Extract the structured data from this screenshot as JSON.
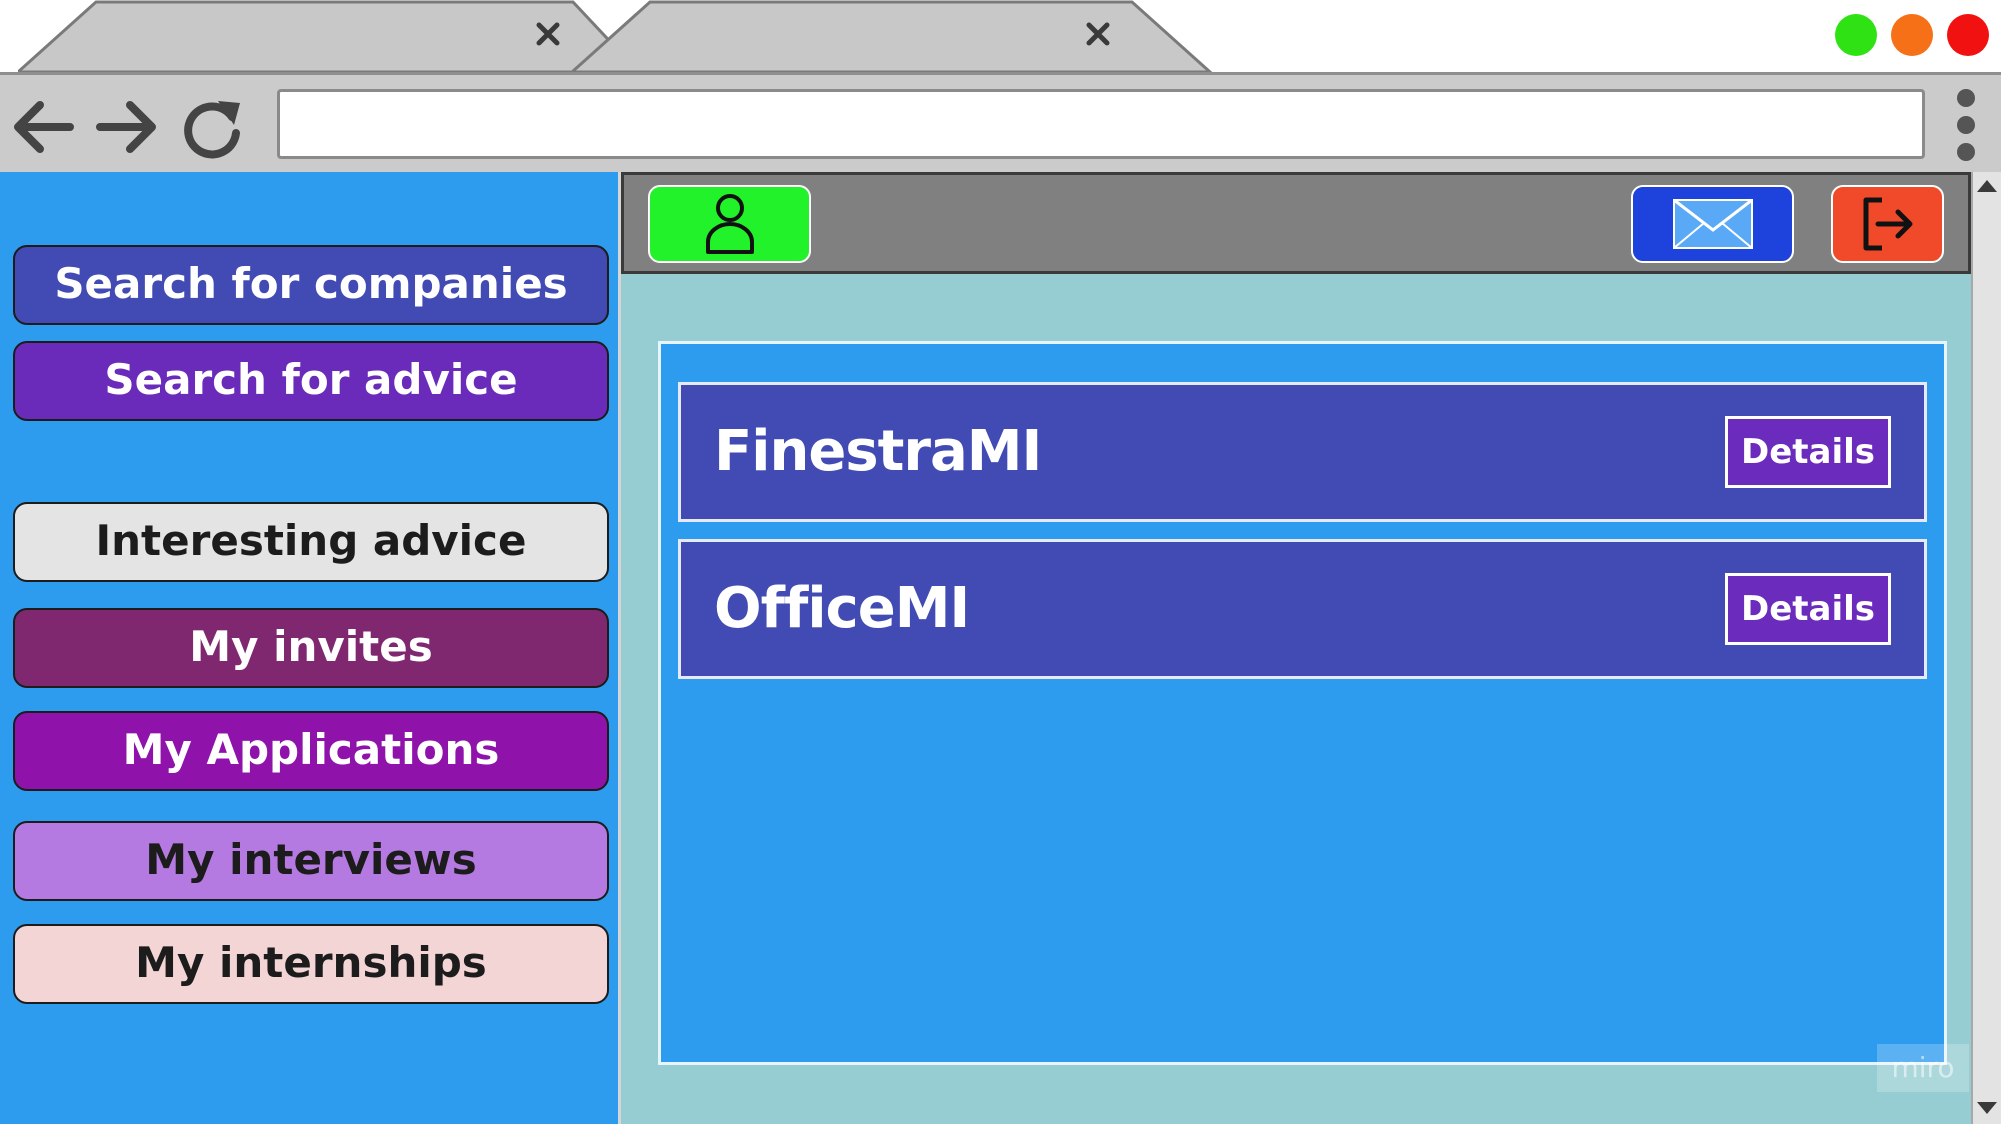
{
  "browser": {
    "tabs": [
      {
        "close_label": "×"
      },
      {
        "close_label": "×"
      }
    ],
    "window_controls": {
      "colors": [
        "#2fe214",
        "#f57017",
        "#f21111"
      ],
      "names": [
        "maximize",
        "minimize",
        "close"
      ]
    },
    "address_bar": {
      "value": "",
      "placeholder": ""
    },
    "nav_icons": [
      "back-arrow-icon",
      "forward-arrow-icon",
      "reload-icon",
      "kebab-menu-icon"
    ]
  },
  "sidebar": {
    "background": "#2d9bee",
    "items": [
      {
        "label": "Search for companies",
        "bg": "#414bb3",
        "color": "#ffffff"
      },
      {
        "label": "Search for advice",
        "bg": "#6a2bbb",
        "color": "#ffffff"
      },
      {
        "label": "Interesting advice",
        "bg": "#e4e4e4",
        "color": "#1c1c1c"
      },
      {
        "label": "My invites",
        "bg": "#7f2870",
        "color": "#ffffff"
      },
      {
        "label": "My Applications",
        "bg": "#8f12ab",
        "color": "#ffffff"
      },
      {
        "label": "My interviews",
        "bg": "#b57ae1",
        "color": "#1c1c1c"
      },
      {
        "label": "My internships",
        "bg": "#f4d5d6",
        "color": "#1c1c1c"
      }
    ]
  },
  "topbar": {
    "profile_button": {
      "icon": "user-icon",
      "bg": "#22f22a"
    },
    "mail_button": {
      "icon": "mail-icon",
      "bg": "#1e42dc"
    },
    "logout_button": {
      "icon": "logout-icon",
      "bg": "#f14a2a"
    }
  },
  "results": {
    "companies": [
      {
        "name": "FinestraMI",
        "details_label": "Details"
      },
      {
        "name": "OfficeMI",
        "details_label": "Details"
      }
    ]
  },
  "watermark": {
    "text": "miro"
  }
}
